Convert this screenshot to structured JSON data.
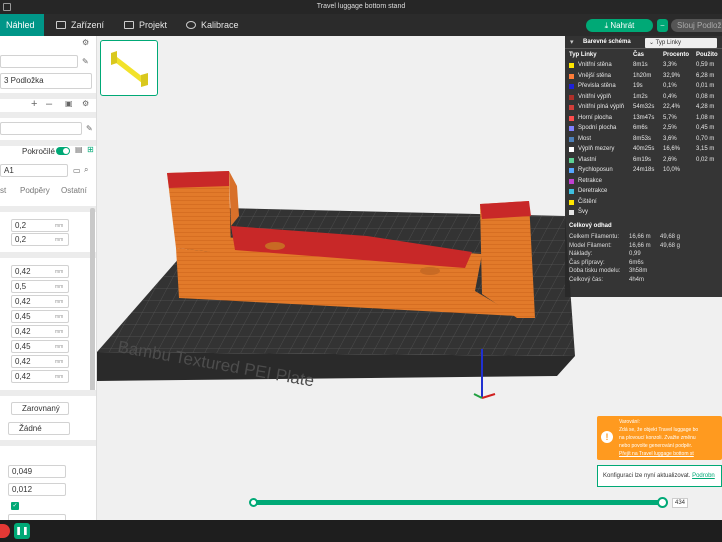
{
  "window": {
    "title": "Travel luggage bottom stand"
  },
  "topbar": {
    "tabs": [
      {
        "label": "Náhled"
      },
      {
        "label": "Zařízení"
      },
      {
        "label": "Projekt"
      },
      {
        "label": "Kalibrace"
      }
    ],
    "print_label": "Nahrát",
    "slice_label": "Slouj Podložka"
  },
  "left": {
    "printer_field": "",
    "plate_field": "3 Podložka",
    "filament_field": "",
    "advanced_label": "Pokročilé",
    "profile_field": "A1",
    "tabs": [
      "st",
      "Podpěry",
      "Ostatní"
    ],
    "values": [
      "0,2",
      "0,2",
      "0,42",
      "0,5",
      "0,42",
      "0,45",
      "0,42",
      "0,45",
      "0,42",
      "0,42"
    ],
    "unit": "mm",
    "seam_select": "Zarovnaný",
    "other_select": "Žádné",
    "value_b1": "0,049",
    "value_b2": "0,012"
  },
  "plate_text": "Bambu Textured PEI Plate",
  "legend": {
    "scheme_label": "Barevné schéma",
    "type_button": "Typ Linky",
    "headers": [
      "Typ Linky",
      "Čas",
      "Procento",
      "Použito"
    ],
    "rows": [
      {
        "name": "Vnitřní stěna",
        "time": "8m1s",
        "pct": "3,3%",
        "used": "0,59 m",
        "color": "#ffe600"
      },
      {
        "name": "Vnější stěna",
        "time": "1h20m",
        "pct": "32,9%",
        "used": "6,28 m",
        "color": "#ff7d38"
      },
      {
        "name": "Převisla stěna",
        "time": "19s",
        "pct": "0,1%",
        "used": "0,01 m",
        "color": "#1d22d8"
      },
      {
        "name": "Vnitřní výplň",
        "time": "1m2s",
        "pct": "0,4%",
        "used": "0,08 m",
        "color": "#b03029"
      },
      {
        "name": "Vnitřní plná výplň",
        "time": "54m32s",
        "pct": "22,4%",
        "used": "4,28 m",
        "color": "#d43f3a"
      },
      {
        "name": "Horní plocha",
        "time": "13m47s",
        "pct": "5,7%",
        "used": "1,08 m",
        "color": "#ff4d4d"
      },
      {
        "name": "Spodní plocha",
        "time": "6m6s",
        "pct": "2,5%",
        "used": "0,45 m",
        "color": "#8080ff"
      },
      {
        "name": "Most",
        "time": "8m53s",
        "pct": "3,6%",
        "used": "0,70 m",
        "color": "#4d80ba"
      },
      {
        "name": "Výplň mezery",
        "time": "40m25s",
        "pct": "16,6%",
        "used": "3,15 m",
        "color": "#ffffff"
      },
      {
        "name": "Vlastní",
        "time": "6m19s",
        "pct": "2,6%",
        "used": "0,02 m",
        "color": "#5ed194"
      },
      {
        "name": "Rychloposun",
        "time": "24m18s",
        "pct": "10,0%",
        "used": "",
        "color": "#56a6ff"
      },
      {
        "name": "Retrakce",
        "time": "",
        "pct": "",
        "used": "",
        "color": "#c040d0"
      },
      {
        "name": "Deretrakce",
        "time": "",
        "pct": "",
        "used": "",
        "color": "#3ec0e0"
      },
      {
        "name": "Čištění",
        "time": "",
        "pct": "",
        "used": "",
        "color": "#ffe600"
      },
      {
        "name": "Švy",
        "time": "",
        "pct": "",
        "used": "",
        "color": "#e6e6e6"
      }
    ],
    "estimate_title": "Celkový odhad",
    "estimates": [
      {
        "label": "Celkem Filamentu:",
        "v1": "16,66 m",
        "v2": "49,68 g"
      },
      {
        "label": "Model Filament:",
        "v1": "16,66 m",
        "v2": "49,68 g"
      },
      {
        "label": "Náklady:",
        "v1": "0,99",
        "v2": ""
      },
      {
        "label": "Čas přípravy:",
        "v1": "6m6s",
        "v2": ""
      },
      {
        "label": "Doba tisku modelu:",
        "v1": "3h58m",
        "v2": ""
      },
      {
        "label": "Celkový čas:",
        "v1": "4h4m",
        "v2": ""
      }
    ]
  },
  "warning": {
    "title": "Varování:",
    "lines": [
      "Zdá se, že objekt Travel luggage bo",
      "na plovoucí konzoli. Zvažte změnu",
      "nebo povolte generování podpěr."
    ],
    "link": "Přejít na Travel luggage bottom st"
  },
  "note": {
    "text": "Konfiguraci lze nyní aktualizovat.",
    "link": "Podrobn"
  },
  "slider": {
    "layer": "434"
  },
  "colors": {
    "accent": "#00a976",
    "warning": "#ff9a1f",
    "model": "#e27a2a",
    "model_top": "#c82828"
  }
}
